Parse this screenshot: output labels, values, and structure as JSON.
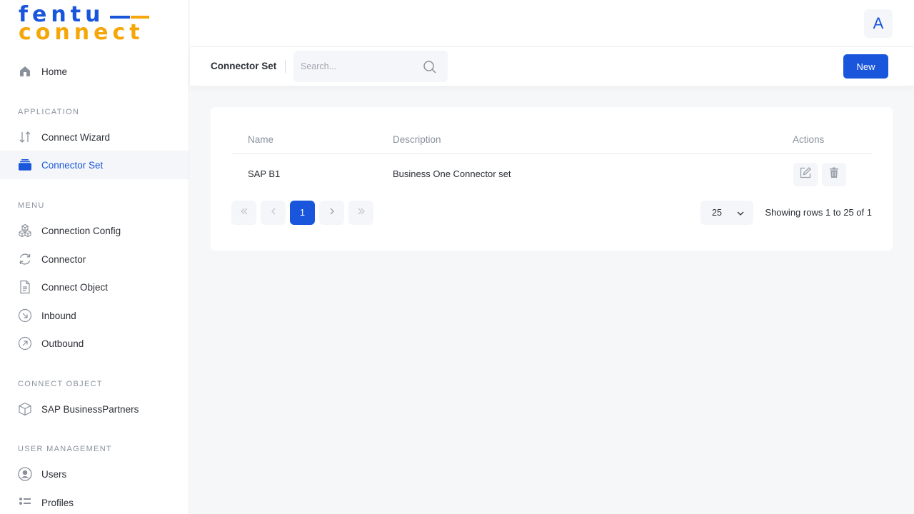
{
  "brand": {
    "line1": "fentu",
    "line2": "connect",
    "blue": "#1a56db",
    "yellow": "#f5a70a"
  },
  "sidebar": {
    "home": {
      "label": "Home",
      "icon": "home-icon"
    },
    "sections": [
      {
        "title": "APPLICATION",
        "items": [
          {
            "label": "Connect Wizard",
            "icon": "arrows-updown-icon"
          },
          {
            "label": "Connector Set",
            "icon": "folder-stack-icon",
            "active": true
          }
        ]
      },
      {
        "title": "MENU",
        "items": [
          {
            "label": "Connection Config",
            "icon": "cubes-icon"
          },
          {
            "label": "Connector",
            "icon": "refresh-icon"
          },
          {
            "label": "Connect Object",
            "icon": "document-icon"
          },
          {
            "label": "Inbound",
            "icon": "arrow-down-right-circle-icon"
          },
          {
            "label": "Outbound",
            "icon": "arrow-up-right-circle-icon"
          }
        ]
      },
      {
        "title": "CONNECT OBJECT",
        "items": [
          {
            "label": "SAP BusinessPartners",
            "icon": "box-icon"
          }
        ]
      },
      {
        "title": "USER MANAGEMENT",
        "items": [
          {
            "label": "Users",
            "icon": "user-circle-icon"
          },
          {
            "label": "Profiles",
            "icon": "list-icon"
          }
        ]
      }
    ]
  },
  "topbar": {
    "avatar_letter": "A"
  },
  "toolbar": {
    "title": "Connector Set",
    "search_placeholder": "Search...",
    "new_label": "New"
  },
  "table": {
    "columns": [
      "Name",
      "Description",
      "Actions"
    ],
    "rows": [
      {
        "name": "SAP B1",
        "description": "Business One Connector set"
      }
    ]
  },
  "pagination": {
    "current_page": "1",
    "rows_per_page": "25",
    "summary": "Showing rows 1 to 25 of 1"
  },
  "colors": {
    "accent": "#1a56db",
    "muted": "#8a919c",
    "surface": "#f4f6f9"
  }
}
